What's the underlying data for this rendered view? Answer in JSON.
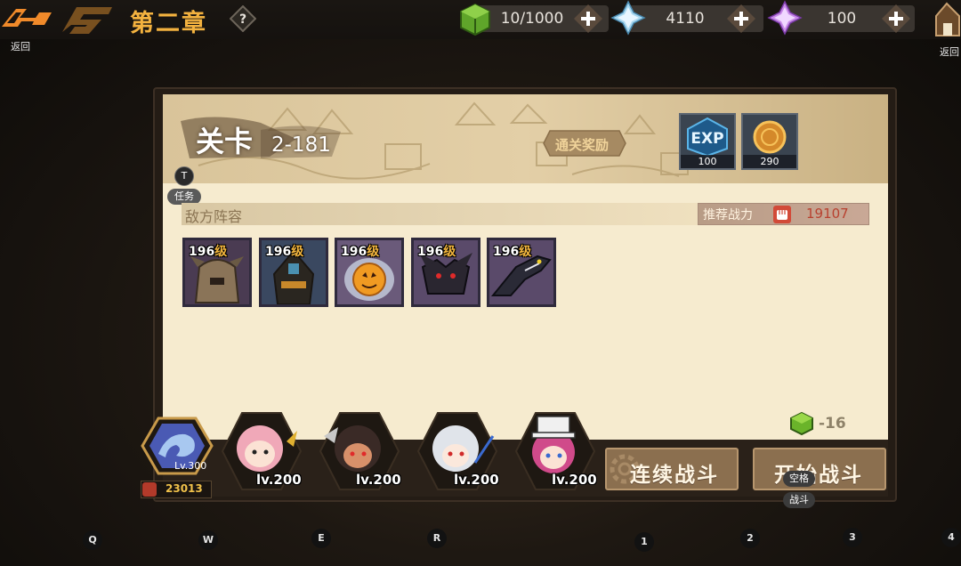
{
  "topbar": {
    "back_label": "返回",
    "chapter_title": "第二章",
    "resources": [
      {
        "icon": "green-cube-icon",
        "value": "10/1000"
      },
      {
        "icon": "blue-crystal-icon",
        "value": "4110"
      },
      {
        "icon": "purple-crystal-icon",
        "value": "100"
      }
    ],
    "home_label": "返回"
  },
  "stage": {
    "label": "关卡",
    "number": "2-181",
    "reward_tag": "通关奖励",
    "rewards": [
      {
        "icon": "exp-icon",
        "label": "EXP",
        "count": "100"
      },
      {
        "icon": "gold-coin-icon",
        "count": "290"
      }
    ]
  },
  "badges": {
    "t_key": "T",
    "task": "任务"
  },
  "enemy": {
    "title": "敌方阵容",
    "power_label": "推荐战力",
    "power_value": "19107",
    "level_suffix": "级",
    "units": [
      {
        "name": "stone-golem",
        "level": "196"
      },
      {
        "name": "dark-tower",
        "level": "196"
      },
      {
        "name": "pumpkin-slime",
        "level": "196"
      },
      {
        "name": "shadow-wolf",
        "level": "196"
      },
      {
        "name": "dark-dragon",
        "level": "196"
      }
    ]
  },
  "cost": {
    "value": "-16"
  },
  "team": {
    "leader_lv": "Lv.300",
    "leader_power": "23013",
    "heroes": [
      {
        "name": "pink-hair-hero",
        "lv": "lv.200"
      },
      {
        "name": "dark-hair-hero",
        "lv": "lv.200"
      },
      {
        "name": "silver-hair-hero",
        "lv": "lv.200"
      },
      {
        "name": "hat-hero",
        "lv": "lv.200"
      }
    ]
  },
  "buttons": {
    "auto_battle": "连续战斗",
    "start_battle": "开始战斗",
    "space_tip": "空格",
    "battle_tip": "战斗"
  },
  "key_hints": [
    "Q",
    "W",
    "E",
    "R",
    "1",
    "2",
    "3",
    "4"
  ],
  "colors": {
    "accent": "#f3b23f",
    "power": "#b8412f",
    "panel": "#f6ebcf"
  }
}
